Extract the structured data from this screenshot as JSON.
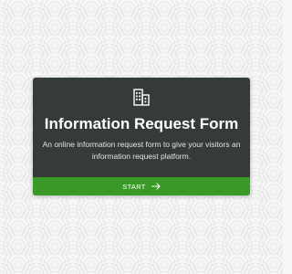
{
  "form": {
    "title": "Information Request Form",
    "description": "An online information request form to give your visitors an information request platform.",
    "start_label": "START",
    "icon": "building-icon"
  },
  "footer": {
    "arrow_icon": "arrow-right-icon"
  },
  "colors": {
    "card_background": "#353b37",
    "button_background": "#3a9a28",
    "page_background": "#f6f6f6"
  }
}
